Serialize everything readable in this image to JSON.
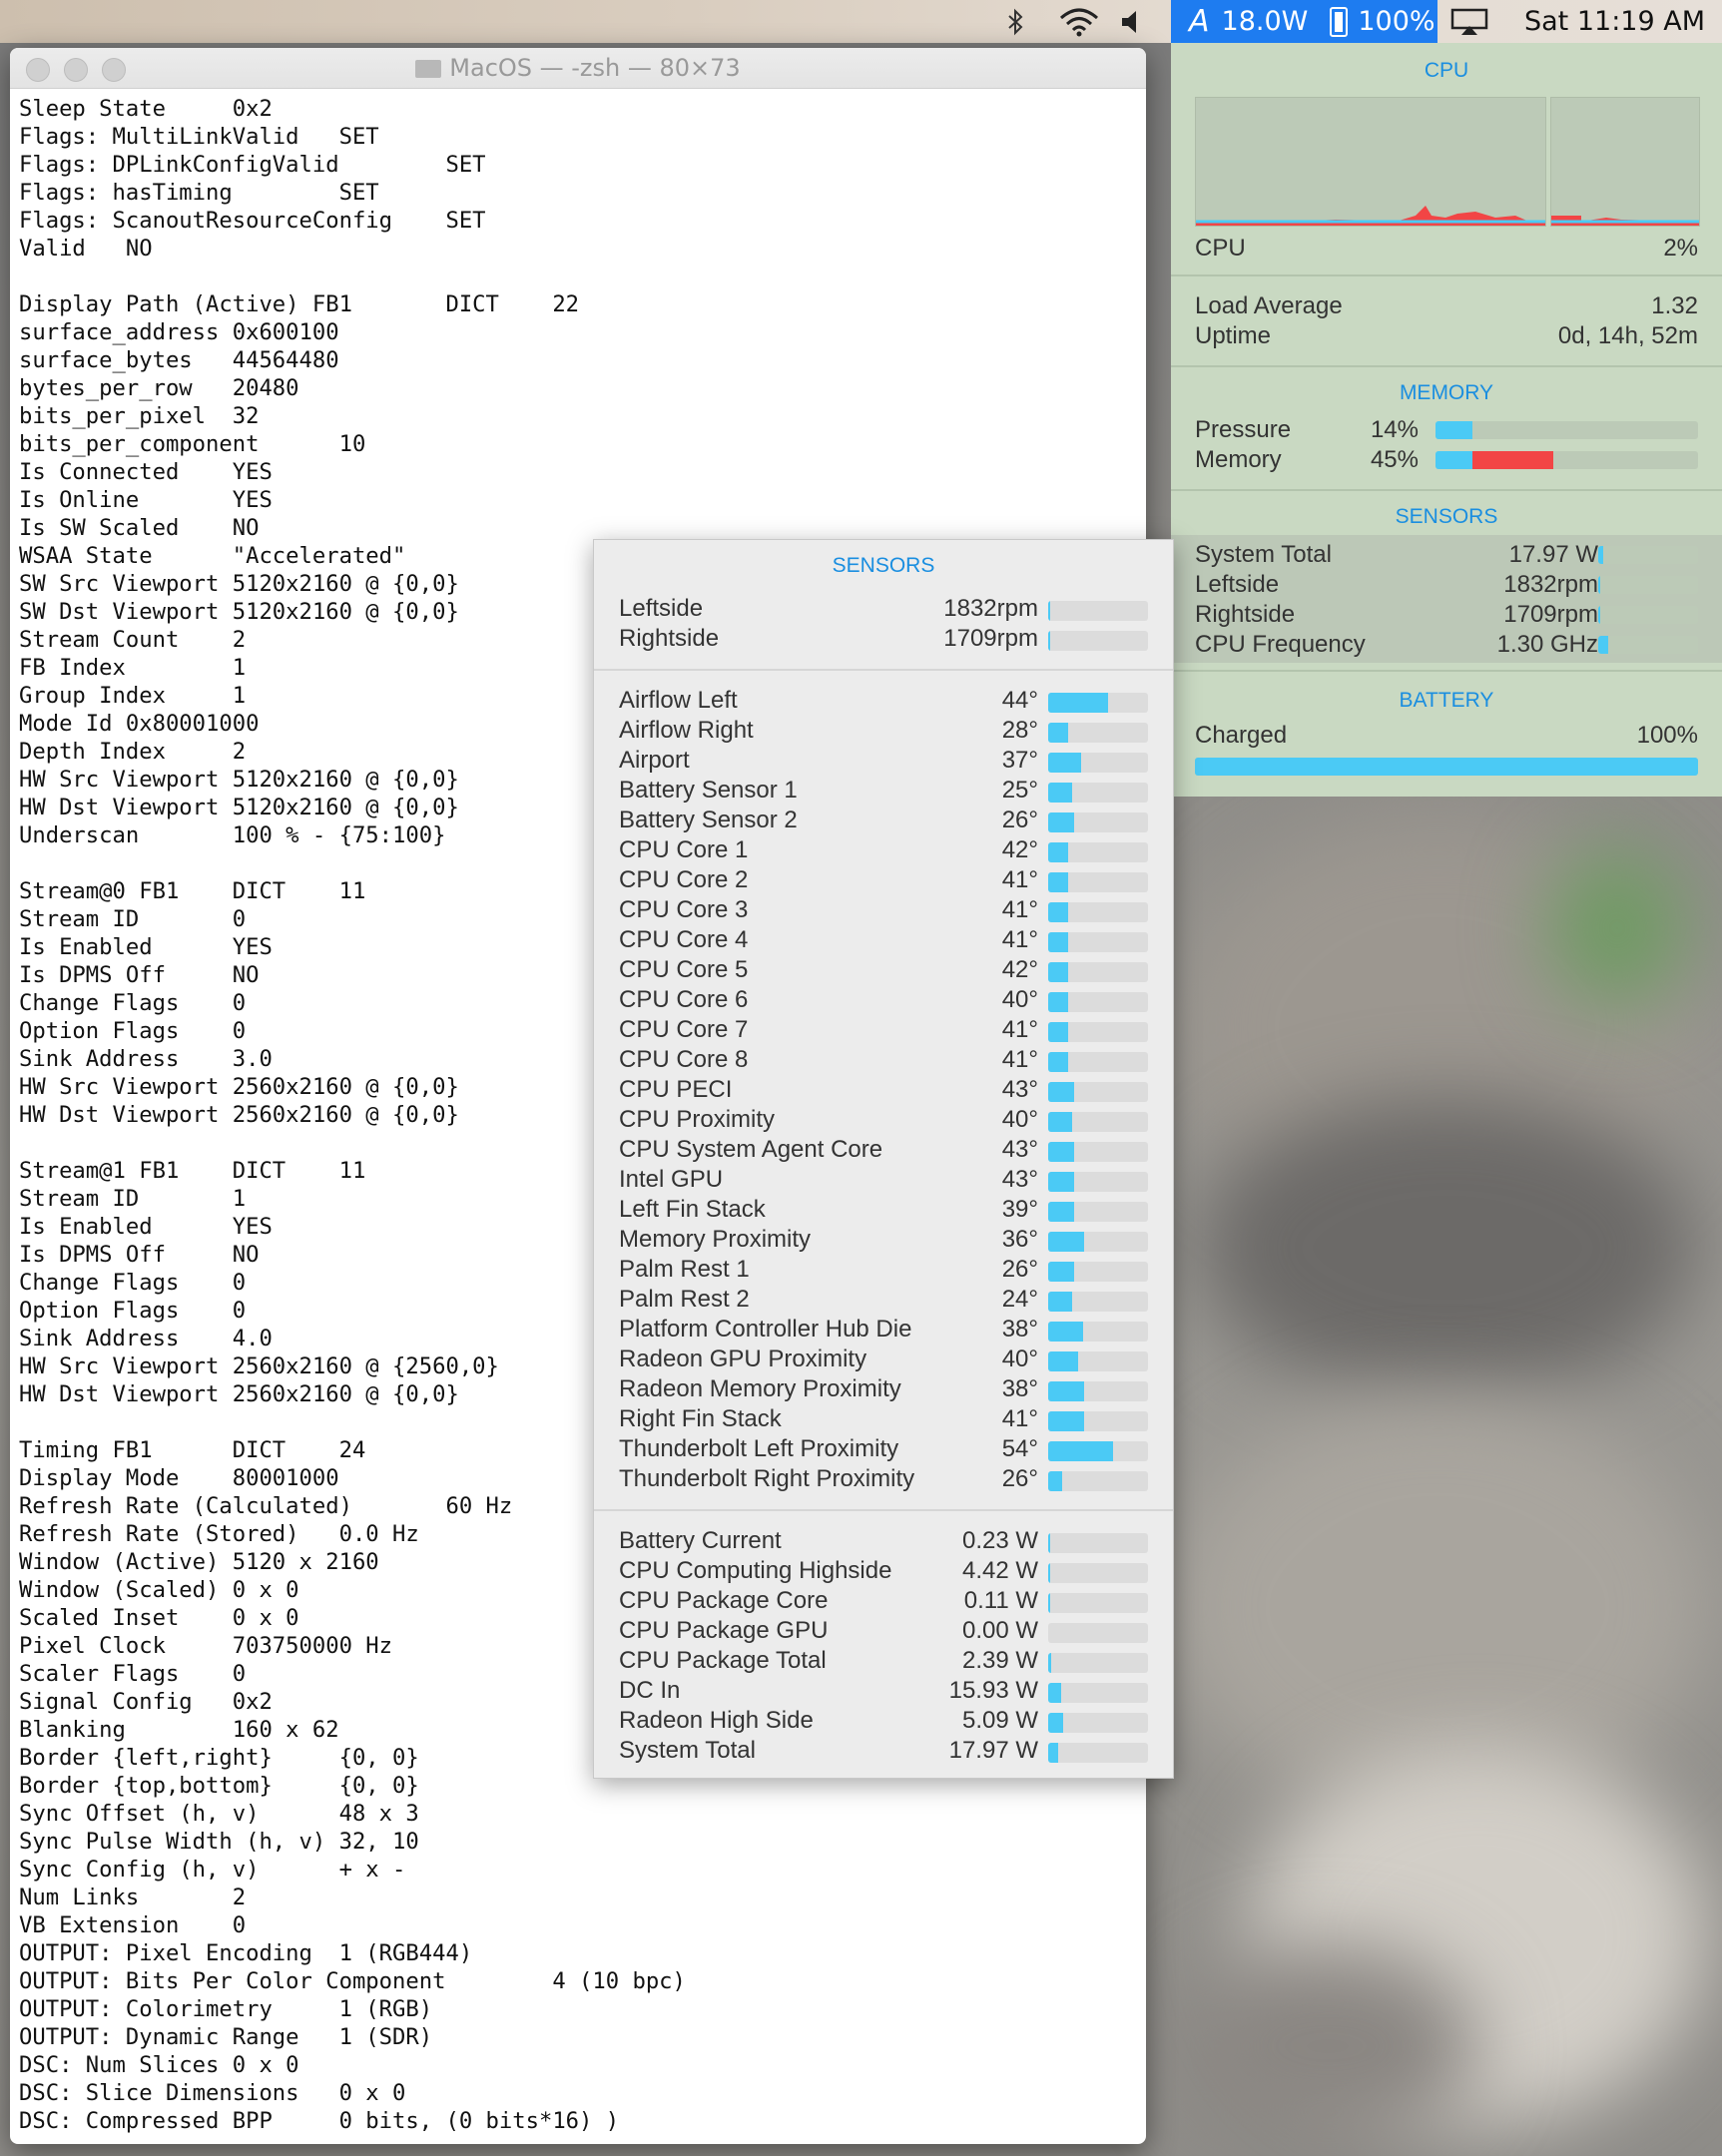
{
  "menubar": {
    "power": "18.0W",
    "battery": "100%",
    "clock": "Sat 11:19 AM"
  },
  "terminal": {
    "title": "MacOS — -zsh — 80×73",
    "lines": [
      "Sleep State     0x2",
      "Flags: MultiLinkValid   SET",
      "Flags: DPLinkConfigValid        SET",
      "Flags: hasTiming        SET",
      "Flags: ScanoutResourceConfig    SET",
      "Valid   NO",
      "",
      "Display Path (Active) FB1       DICT    22",
      "surface_address 0x600100",
      "surface_bytes   44564480",
      "bytes_per_row   20480",
      "bits_per_pixel  32",
      "bits_per_component      10",
      "Is Connected    YES",
      "Is Online       YES",
      "Is SW Scaled    NO",
      "WSAA State      \"Accelerated\"",
      "SW Src Viewport 5120x2160 @ {0,0}",
      "SW Dst Viewport 5120x2160 @ {0,0}",
      "Stream Count    2",
      "FB Index        1",
      "Group Index     1",
      "Mode Id 0x80001000",
      "Depth Index     2",
      "HW Src Viewport 5120x2160 @ {0,0}",
      "HW Dst Viewport 5120x2160 @ {0,0}",
      "Underscan       100 % - {75:100}",
      "",
      "Stream@0 FB1    DICT    11",
      "Stream ID       0",
      "Is Enabled      YES",
      "Is DPMS Off     NO",
      "Change Flags    0",
      "Option Flags    0",
      "Sink Address    3.0",
      "HW Src Viewport 2560x2160 @ {0,0}",
      "HW Dst Viewport 2560x2160 @ {0,0}",
      "",
      "Stream@1 FB1    DICT    11",
      "Stream ID       1",
      "Is Enabled      YES",
      "Is DPMS Off     NO",
      "Change Flags    0",
      "Option Flags    0",
      "Sink Address    4.0",
      "HW Src Viewport 2560x2160 @ {2560,0}",
      "HW Dst Viewport 2560x2160 @ {0,0}",
      "",
      "Timing FB1      DICT    24",
      "Display Mode    80001000",
      "Refresh Rate (Calculated)       60 Hz",
      "Refresh Rate (Stored)   0.0 Hz",
      "Window (Active) 5120 x 2160",
      "Window (Scaled) 0 x 0",
      "Scaled Inset    0 x 0",
      "Pixel Clock     703750000 Hz",
      "Scaler Flags    0",
      "Signal Config   0x2",
      "Blanking        160 x 62",
      "Border {left,right}     {0, 0}",
      "Border {top,bottom}     {0, 0}",
      "Sync Offset (h, v)      48 x 3",
      "Sync Pulse Width (h, v) 32, 10",
      "Sync Config (h, v)      + x -",
      "Num Links       2",
      "VB Extension    0",
      "OUTPUT: Pixel Encoding  1 (RGB444)",
      "OUTPUT: Bits Per Color Component        4 (10 bpc)",
      "OUTPUT: Colorimetry     1 (RGB)",
      "OUTPUT: Dynamic Range   1 (SDR)",
      "DSC: Num Slices 0 x 0",
      "DSC: Slice Dimensions   0 x 0",
      "DSC: Compressed BPP     0 bits, (0 bits*16) )"
    ]
  },
  "istat": {
    "cpu_title": "CPU",
    "cpu_label": "CPU",
    "cpu_value": "2%",
    "load_label": "Load Average",
    "load_value": "1.32",
    "uptime_label": "Uptime",
    "uptime_value": "0d, 14h, 52m",
    "memory_title": "MEMORY",
    "pressure_label": "Pressure",
    "pressure_value": "14%",
    "pressure_level": 0.14,
    "memory_label": "Memory",
    "memory_value": "45%",
    "memory_level": 0.45,
    "sensors_title": "SENSORS",
    "sensors": [
      {
        "label": "System Total",
        "value": "17.97 W",
        "level": 0.05
      },
      {
        "label": "Leftside",
        "value": "1832rpm",
        "level": 0.02
      },
      {
        "label": "Rightside",
        "value": "1709rpm",
        "level": 0.02
      },
      {
        "label": "CPU Frequency",
        "value": "1.30 GHz",
        "level": 0.1
      }
    ],
    "battery_title": "BATTERY",
    "battery_label": "Charged",
    "battery_value": "100%",
    "battery_level": 1.0
  },
  "sensors_popover": {
    "title": "SENSORS",
    "fans": [
      {
        "label": "Leftside",
        "value": "1832rpm",
        "level": 0.01
      },
      {
        "label": "Rightside",
        "value": "1709rpm",
        "level": 0.01
      }
    ],
    "temps": [
      {
        "label": "Airflow Left",
        "value": "44°",
        "level": 0.6
      },
      {
        "label": "Airflow Right",
        "value": "28°",
        "level": 0.2
      },
      {
        "label": "Airport",
        "value": "37°",
        "level": 0.33
      },
      {
        "label": "Battery Sensor 1",
        "value": "25°",
        "level": 0.24
      },
      {
        "label": "Battery Sensor 2",
        "value": "26°",
        "level": 0.26
      },
      {
        "label": "CPU Core 1",
        "value": "42°",
        "level": 0.2
      },
      {
        "label": "CPU Core 2",
        "value": "41°",
        "level": 0.2
      },
      {
        "label": "CPU Core 3",
        "value": "41°",
        "level": 0.2
      },
      {
        "label": "CPU Core 4",
        "value": "41°",
        "level": 0.2
      },
      {
        "label": "CPU Core 5",
        "value": "42°",
        "level": 0.2
      },
      {
        "label": "CPU Core 6",
        "value": "40°",
        "level": 0.2
      },
      {
        "label": "CPU Core 7",
        "value": "41°",
        "level": 0.2
      },
      {
        "label": "CPU Core 8",
        "value": "41°",
        "level": 0.2
      },
      {
        "label": "CPU PECI",
        "value": "43°",
        "level": 0.26
      },
      {
        "label": "CPU Proximity",
        "value": "40°",
        "level": 0.24
      },
      {
        "label": "CPU System Agent Core",
        "value": "43°",
        "level": 0.26
      },
      {
        "label": "Intel GPU",
        "value": "43°",
        "level": 0.26
      },
      {
        "label": "Left Fin Stack",
        "value": "39°",
        "level": 0.26
      },
      {
        "label": "Memory Proximity",
        "value": "36°",
        "level": 0.36
      },
      {
        "label": "Palm Rest 1",
        "value": "26°",
        "level": 0.26
      },
      {
        "label": "Palm Rest 2",
        "value": "24°",
        "level": 0.24
      },
      {
        "label": "Platform Controller Hub Die",
        "value": "38°",
        "level": 0.35
      },
      {
        "label": "Radeon GPU Proximity",
        "value": "40°",
        "level": 0.3
      },
      {
        "label": "Radeon Memory Proximity",
        "value": "38°",
        "level": 0.36
      },
      {
        "label": "Right Fin Stack",
        "value": "41°",
        "level": 0.36
      },
      {
        "label": "Thunderbolt Left Proximity",
        "value": "54°",
        "level": 0.65
      },
      {
        "label": "Thunderbolt Right Proximity",
        "value": "26°",
        "level": 0.14
      }
    ],
    "power": [
      {
        "label": "Battery Current",
        "value": "0.23 W",
        "level": 0.02
      },
      {
        "label": "CPU Computing Highside",
        "value": "4.42 W",
        "level": 0.02
      },
      {
        "label": "CPU Package Core",
        "value": "0.11 W",
        "level": 0.02
      },
      {
        "label": "CPU Package GPU",
        "value": "0.00 W",
        "level": 0.0
      },
      {
        "label": "CPU Package Total",
        "value": "2.39 W",
        "level": 0.03
      },
      {
        "label": "DC In",
        "value": "15.93 W",
        "level": 0.13
      },
      {
        "label": "Radeon High Side",
        "value": "5.09 W",
        "level": 0.15
      },
      {
        "label": "System Total",
        "value": "17.97 W",
        "level": 0.1
      }
    ]
  },
  "colors": {
    "accent_blue": "#4bcaf5",
    "accent_red": "#f24545",
    "title_blue": "#1a8ee0"
  }
}
